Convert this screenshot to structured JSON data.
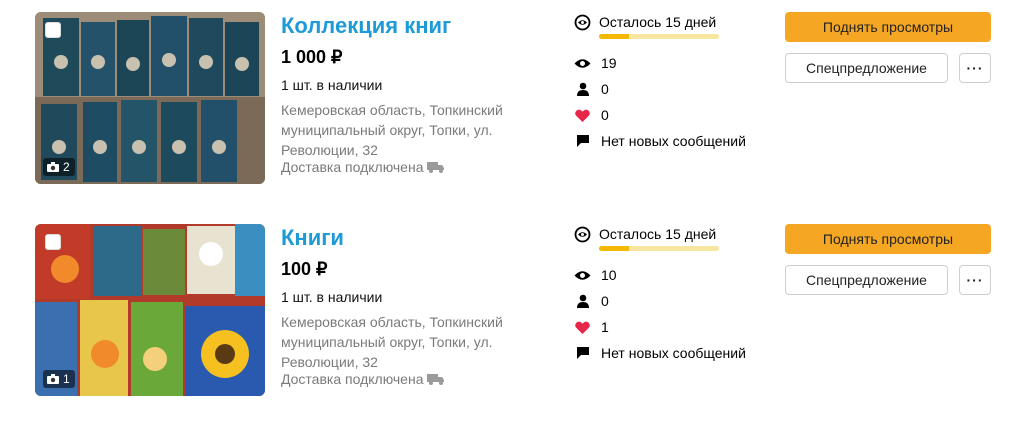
{
  "listings": [
    {
      "title": "Коллекция книг",
      "price": "1 000 ₽",
      "stock": "1 шт. в наличии",
      "address": "Кемеровская область, Топкинский муниципальный округ, Топки, ул. Революции, 32",
      "delivery": "Доставка подключена",
      "photo_count": "2",
      "days_left": "Осталось 15 дней",
      "days_progress": 0.25,
      "views": "19",
      "contacts": "0",
      "favorites": "0",
      "messages": "Нет новых сообщений",
      "raise_button": "Поднять просмотры",
      "special_button": "Спецпредложение",
      "more_button": "···"
    },
    {
      "title": "Книги",
      "price": "100 ₽",
      "stock": "1 шт. в наличии",
      "address": "Кемеровская область, Топкинский муниципальный округ, Топки, ул. Революции, 32",
      "delivery": "Доставка подключена",
      "photo_count": "1",
      "days_left": "Осталось 15 дней",
      "days_progress": 0.25,
      "views": "10",
      "contacts": "0",
      "favorites": "1",
      "messages": "Нет новых сообщений",
      "raise_button": "Поднять просмотры",
      "special_button": "Спецпредложение",
      "more_button": "···"
    }
  ],
  "colors": {
    "title": "#1e9bd7",
    "raise_button_bg": "#f5a623",
    "progress_fill": "#f5b800",
    "progress_track": "#f6e6a0",
    "heart": "#e8264a"
  }
}
